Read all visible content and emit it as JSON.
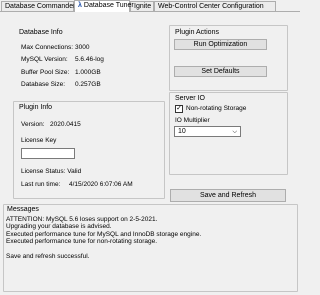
{
  "tabs": [
    "Database Commander",
    "Database Tuner",
    "Ignite",
    "Web-Control Center Configuration"
  ],
  "active_tab_icon": "tuner-icon",
  "database_info": {
    "title": "Database Info",
    "max_connections_label": "Max Connections:",
    "max_connections_value": "3000",
    "mysql_version_label": "MySQL Version:",
    "mysql_version_value": "5.6.46-log",
    "buffer_pool_label": "Buffer Pool Size:",
    "buffer_pool_value": "1.000GB",
    "database_size_label": "Database Size:",
    "database_size_value": "0.257GB"
  },
  "plugin_actions": {
    "title": "Plugin Actions",
    "run_optimization": "Run Optimization",
    "set_defaults": "Set Defaults"
  },
  "plugin_info": {
    "title": "Plugin Info",
    "version_label": "Version:",
    "version_value": "2020.0415",
    "license_key_label": "License Key",
    "license_key_value": "",
    "license_status": "License Status: Valid",
    "last_run_label": "Last run time:",
    "last_run_value": "4/15/2020 6:07:06 AM"
  },
  "server_io": {
    "title": "Server IO",
    "non_rotating_label": "Non-rotating Storage",
    "non_rotating_checked": true,
    "io_multiplier_label": "IO Multiplier",
    "io_multiplier_value": "10"
  },
  "save_refresh": "Save and Refresh",
  "messages": {
    "title": "Messages",
    "lines": [
      "ATTENTION: MySQL 5.6 loses support on 2-5-2021.",
      "Upgrading your database is advised.",
      "Executed performance tune for MySQL and InnoDB storage engine.",
      "Executed performance tune for non-rotating storage.",
      "",
      "Save and refresh successful."
    ]
  }
}
